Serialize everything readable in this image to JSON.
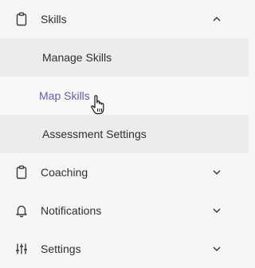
{
  "nav": {
    "skills": {
      "label": "Skills",
      "icon": "clipboard-icon",
      "expanded": true,
      "children": [
        {
          "label": "Manage Skills"
        },
        {
          "label": "Map Skills",
          "hovered": true
        },
        {
          "label": "Assessment Settings"
        }
      ]
    },
    "coaching": {
      "label": "Coaching",
      "icon": "clipboard-icon"
    },
    "notifications": {
      "label": "Notifications",
      "icon": "bell-icon"
    },
    "settings": {
      "label": "Settings",
      "icon": "sliders-icon"
    }
  },
  "colors": {
    "active_text": "#6b5aa6",
    "submenu_bg": "#ececec",
    "background": "#f5f5f5"
  }
}
